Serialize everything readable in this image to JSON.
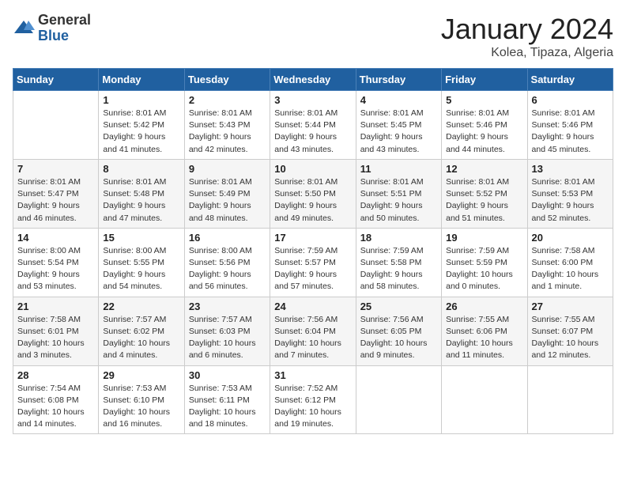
{
  "logo": {
    "general": "General",
    "blue": "Blue"
  },
  "title": {
    "month_year": "January 2024",
    "location": "Kolea, Tipaza, Algeria"
  },
  "weekdays": [
    "Sunday",
    "Monday",
    "Tuesday",
    "Wednesday",
    "Thursday",
    "Friday",
    "Saturday"
  ],
  "weeks": [
    [
      {
        "day": "",
        "sunrise": "",
        "sunset": "",
        "daylight": ""
      },
      {
        "day": "1",
        "sunrise": "Sunrise: 8:01 AM",
        "sunset": "Sunset: 5:42 PM",
        "daylight": "Daylight: 9 hours and 41 minutes."
      },
      {
        "day": "2",
        "sunrise": "Sunrise: 8:01 AM",
        "sunset": "Sunset: 5:43 PM",
        "daylight": "Daylight: 9 hours and 42 minutes."
      },
      {
        "day": "3",
        "sunrise": "Sunrise: 8:01 AM",
        "sunset": "Sunset: 5:44 PM",
        "daylight": "Daylight: 9 hours and 43 minutes."
      },
      {
        "day": "4",
        "sunrise": "Sunrise: 8:01 AM",
        "sunset": "Sunset: 5:45 PM",
        "daylight": "Daylight: 9 hours and 43 minutes."
      },
      {
        "day": "5",
        "sunrise": "Sunrise: 8:01 AM",
        "sunset": "Sunset: 5:46 PM",
        "daylight": "Daylight: 9 hours and 44 minutes."
      },
      {
        "day": "6",
        "sunrise": "Sunrise: 8:01 AM",
        "sunset": "Sunset: 5:46 PM",
        "daylight": "Daylight: 9 hours and 45 minutes."
      }
    ],
    [
      {
        "day": "7",
        "sunrise": "Sunrise: 8:01 AM",
        "sunset": "Sunset: 5:47 PM",
        "daylight": "Daylight: 9 hours and 46 minutes."
      },
      {
        "day": "8",
        "sunrise": "Sunrise: 8:01 AM",
        "sunset": "Sunset: 5:48 PM",
        "daylight": "Daylight: 9 hours and 47 minutes."
      },
      {
        "day": "9",
        "sunrise": "Sunrise: 8:01 AM",
        "sunset": "Sunset: 5:49 PM",
        "daylight": "Daylight: 9 hours and 48 minutes."
      },
      {
        "day": "10",
        "sunrise": "Sunrise: 8:01 AM",
        "sunset": "Sunset: 5:50 PM",
        "daylight": "Daylight: 9 hours and 49 minutes."
      },
      {
        "day": "11",
        "sunrise": "Sunrise: 8:01 AM",
        "sunset": "Sunset: 5:51 PM",
        "daylight": "Daylight: 9 hours and 50 minutes."
      },
      {
        "day": "12",
        "sunrise": "Sunrise: 8:01 AM",
        "sunset": "Sunset: 5:52 PM",
        "daylight": "Daylight: 9 hours and 51 minutes."
      },
      {
        "day": "13",
        "sunrise": "Sunrise: 8:01 AM",
        "sunset": "Sunset: 5:53 PM",
        "daylight": "Daylight: 9 hours and 52 minutes."
      }
    ],
    [
      {
        "day": "14",
        "sunrise": "Sunrise: 8:00 AM",
        "sunset": "Sunset: 5:54 PM",
        "daylight": "Daylight: 9 hours and 53 minutes."
      },
      {
        "day": "15",
        "sunrise": "Sunrise: 8:00 AM",
        "sunset": "Sunset: 5:55 PM",
        "daylight": "Daylight: 9 hours and 54 minutes."
      },
      {
        "day": "16",
        "sunrise": "Sunrise: 8:00 AM",
        "sunset": "Sunset: 5:56 PM",
        "daylight": "Daylight: 9 hours and 56 minutes."
      },
      {
        "day": "17",
        "sunrise": "Sunrise: 7:59 AM",
        "sunset": "Sunset: 5:57 PM",
        "daylight": "Daylight: 9 hours and 57 minutes."
      },
      {
        "day": "18",
        "sunrise": "Sunrise: 7:59 AM",
        "sunset": "Sunset: 5:58 PM",
        "daylight": "Daylight: 9 hours and 58 minutes."
      },
      {
        "day": "19",
        "sunrise": "Sunrise: 7:59 AM",
        "sunset": "Sunset: 5:59 PM",
        "daylight": "Daylight: 10 hours and 0 minutes."
      },
      {
        "day": "20",
        "sunrise": "Sunrise: 7:58 AM",
        "sunset": "Sunset: 6:00 PM",
        "daylight": "Daylight: 10 hours and 1 minute."
      }
    ],
    [
      {
        "day": "21",
        "sunrise": "Sunrise: 7:58 AM",
        "sunset": "Sunset: 6:01 PM",
        "daylight": "Daylight: 10 hours and 3 minutes."
      },
      {
        "day": "22",
        "sunrise": "Sunrise: 7:57 AM",
        "sunset": "Sunset: 6:02 PM",
        "daylight": "Daylight: 10 hours and 4 minutes."
      },
      {
        "day": "23",
        "sunrise": "Sunrise: 7:57 AM",
        "sunset": "Sunset: 6:03 PM",
        "daylight": "Daylight: 10 hours and 6 minutes."
      },
      {
        "day": "24",
        "sunrise": "Sunrise: 7:56 AM",
        "sunset": "Sunset: 6:04 PM",
        "daylight": "Daylight: 10 hours and 7 minutes."
      },
      {
        "day": "25",
        "sunrise": "Sunrise: 7:56 AM",
        "sunset": "Sunset: 6:05 PM",
        "daylight": "Daylight: 10 hours and 9 minutes."
      },
      {
        "day": "26",
        "sunrise": "Sunrise: 7:55 AM",
        "sunset": "Sunset: 6:06 PM",
        "daylight": "Daylight: 10 hours and 11 minutes."
      },
      {
        "day": "27",
        "sunrise": "Sunrise: 7:55 AM",
        "sunset": "Sunset: 6:07 PM",
        "daylight": "Daylight: 10 hours and 12 minutes."
      }
    ],
    [
      {
        "day": "28",
        "sunrise": "Sunrise: 7:54 AM",
        "sunset": "Sunset: 6:08 PM",
        "daylight": "Daylight: 10 hours and 14 minutes."
      },
      {
        "day": "29",
        "sunrise": "Sunrise: 7:53 AM",
        "sunset": "Sunset: 6:10 PM",
        "daylight": "Daylight: 10 hours and 16 minutes."
      },
      {
        "day": "30",
        "sunrise": "Sunrise: 7:53 AM",
        "sunset": "Sunset: 6:11 PM",
        "daylight": "Daylight: 10 hours and 18 minutes."
      },
      {
        "day": "31",
        "sunrise": "Sunrise: 7:52 AM",
        "sunset": "Sunset: 6:12 PM",
        "daylight": "Daylight: 10 hours and 19 minutes."
      },
      {
        "day": "",
        "sunrise": "",
        "sunset": "",
        "daylight": ""
      },
      {
        "day": "",
        "sunrise": "",
        "sunset": "",
        "daylight": ""
      },
      {
        "day": "",
        "sunrise": "",
        "sunset": "",
        "daylight": ""
      }
    ]
  ]
}
